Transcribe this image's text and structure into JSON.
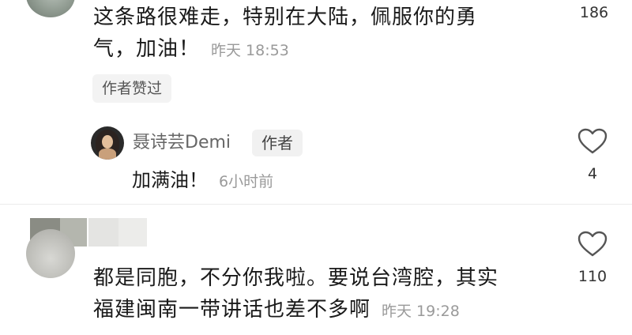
{
  "comments": [
    {
      "text_line1": "这条路很难走，特别在大陆，佩服你的勇",
      "text_line2": "气，加油！",
      "time": "昨天 18:53",
      "likes": "186",
      "author_liked_badge": "作者赞过"
    },
    {
      "text_line1": "都是同胞，不分你我啦。要说台湾腔，其实",
      "text_line2": "福建闽南一带讲话也差不多啊",
      "time": "昨天 19:28",
      "likes": "110"
    }
  ],
  "reply": {
    "username": "聂诗芸Demi",
    "author_tag": "作者",
    "text": "加满油！",
    "time": "6小时前",
    "likes": "4"
  },
  "icons": {
    "like": "heart-outline-icon"
  },
  "colors": {
    "text": "#1a1a1a",
    "meta": "#9a9a9a",
    "badge_bg": "#f3f3f3"
  }
}
